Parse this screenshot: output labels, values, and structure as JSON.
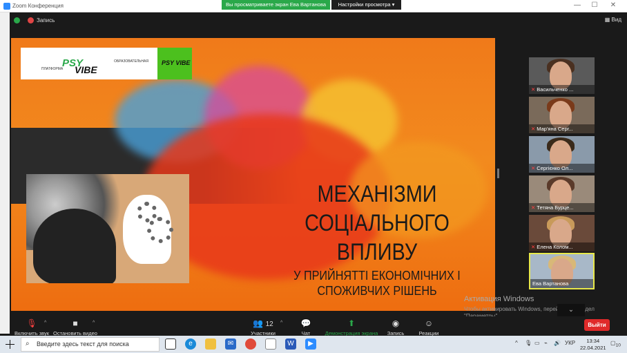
{
  "window": {
    "title": "Zoom Конференция",
    "minimize": "—",
    "maximize": "☐",
    "close": "✕"
  },
  "banner": {
    "sharing_text": "Вы просматриваете экран Ева Вартанова",
    "view_settings": "Настройки просмотра"
  },
  "topbar": {
    "record_label": "Запись",
    "view_label": "Вид"
  },
  "slide": {
    "logo_text_top": "PSY",
    "logo_text_bottom": "VIBE",
    "logo_small_left": "ПЛАТФОРМА",
    "logo_small_right": "ОБРАЗОВАТЕЛЬНАЯ",
    "logo_green_text": "PSY VIBE",
    "title_lines": [
      "МЕХАНІЗМИ",
      "СОЦІАЛЬНОГО",
      "ВПЛИВУ"
    ],
    "subtitle_lines": [
      "У ПРИЙНЯТТІ ЕКОНОМІЧНИХ І",
      "СПОЖИВЧИХ РІШЕНЬ"
    ]
  },
  "participants": [
    {
      "name": "Васильченко ...",
      "muted": true
    },
    {
      "name": "Мар'яна Серг...",
      "muted": true
    },
    {
      "name": "Сергієнко Ол...",
      "muted": true
    },
    {
      "name": "Тетяна Бурце...",
      "muted": true
    },
    {
      "name": "Елена Колом...",
      "muted": true
    },
    {
      "name": "Ева Вартанова",
      "muted": false
    }
  ],
  "watermark": {
    "title": "Активация Windows",
    "text": "Чтобы активировать Windows, перейдите в раздел \"Параметры\"."
  },
  "toolbar": {
    "audio": "Включить звук",
    "video": "Остановить видео",
    "participants": "Участники",
    "participants_count": "12",
    "chat": "Чат",
    "share": "Демонстрация экрана",
    "record": "Запись",
    "reactions": "Реакции",
    "leave": "Выйти"
  },
  "taskbar": {
    "search_placeholder": "Введите здесь текст для поиска",
    "lang": "УКР",
    "time": "13:34",
    "date": "22.04.2021",
    "notifications": "10"
  },
  "colors": {
    "accent_green": "#2aa84a",
    "slide_orange": "#f07a1a",
    "leave_red": "#e02a2a"
  }
}
